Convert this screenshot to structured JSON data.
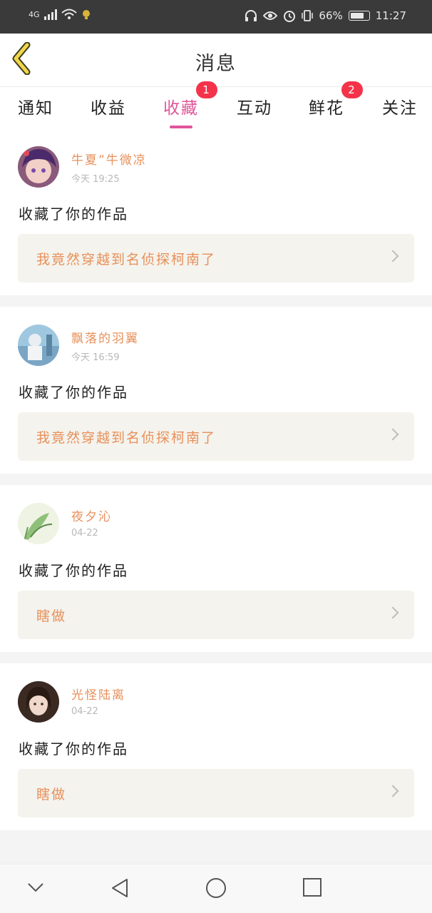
{
  "status_bar": {
    "network": "4G",
    "battery": "66%",
    "time": "11:27"
  },
  "header": {
    "title": "消息"
  },
  "tabs": [
    {
      "label": "通知",
      "badge": ""
    },
    {
      "label": "收益",
      "badge": ""
    },
    {
      "label": "收藏",
      "badge": "1"
    },
    {
      "label": "互动",
      "badge": ""
    },
    {
      "label": "鲜花",
      "badge": "2"
    },
    {
      "label": "关注",
      "badge": ""
    }
  ],
  "active_tab": "收藏",
  "messages": [
    {
      "user": "牛夏”牛微凉",
      "time": "今天 19:25",
      "action": "收藏了你的作品",
      "work": "我竟然穿越到名侦探柯南了"
    },
    {
      "user": "飘落的羽翼",
      "time": "今天 16:59",
      "action": "收藏了你的作品",
      "work": "我竟然穿越到名侦探柯南了"
    },
    {
      "user": "夜夕沁",
      "time": "04-22",
      "action": "收藏了你的作品",
      "work": "瞎做"
    },
    {
      "user": "光怪陆离",
      "time": "04-22",
      "action": "收藏了你的作品",
      "work": "瞎做"
    }
  ],
  "colors": {
    "accent_pink": "#e0559a",
    "badge_red": "#f4334a",
    "username_orange": "#e8905a",
    "link_bg": "#f4f3ed"
  },
  "icons": {
    "back": "chevron-left-icon",
    "nav_back": "triangle-back-icon",
    "nav_home": "circle-home-icon",
    "nav_recent": "square-recent-icon",
    "nav_hide": "chevron-down-icon"
  }
}
